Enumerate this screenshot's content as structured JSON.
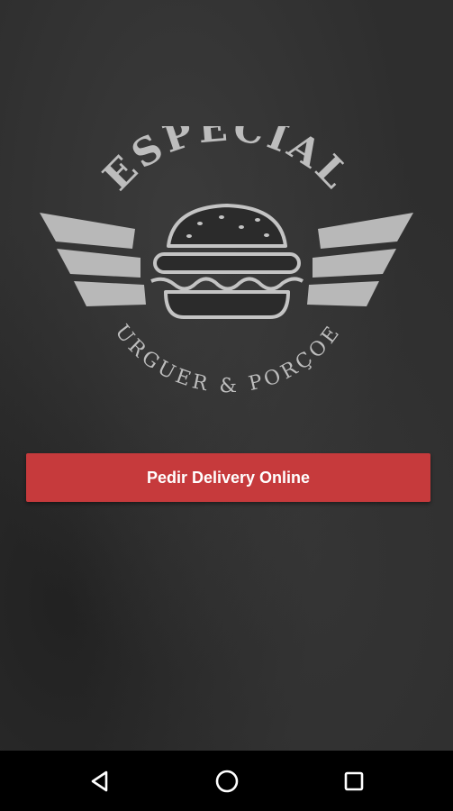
{
  "logo": {
    "title": "ESPECIAL",
    "subtitle": "BURGUER & PORÇOES"
  },
  "actions": {
    "order_label": "Pedir Delivery Online"
  },
  "colors": {
    "background": "#2e2e2e",
    "button": "#c63a3c",
    "logo_gray": "#bdbdbd",
    "nav_bar": "#000000"
  },
  "nav": {
    "back_icon": "back-triangle-icon",
    "home_icon": "home-circle-icon",
    "recents_icon": "recents-square-icon"
  }
}
